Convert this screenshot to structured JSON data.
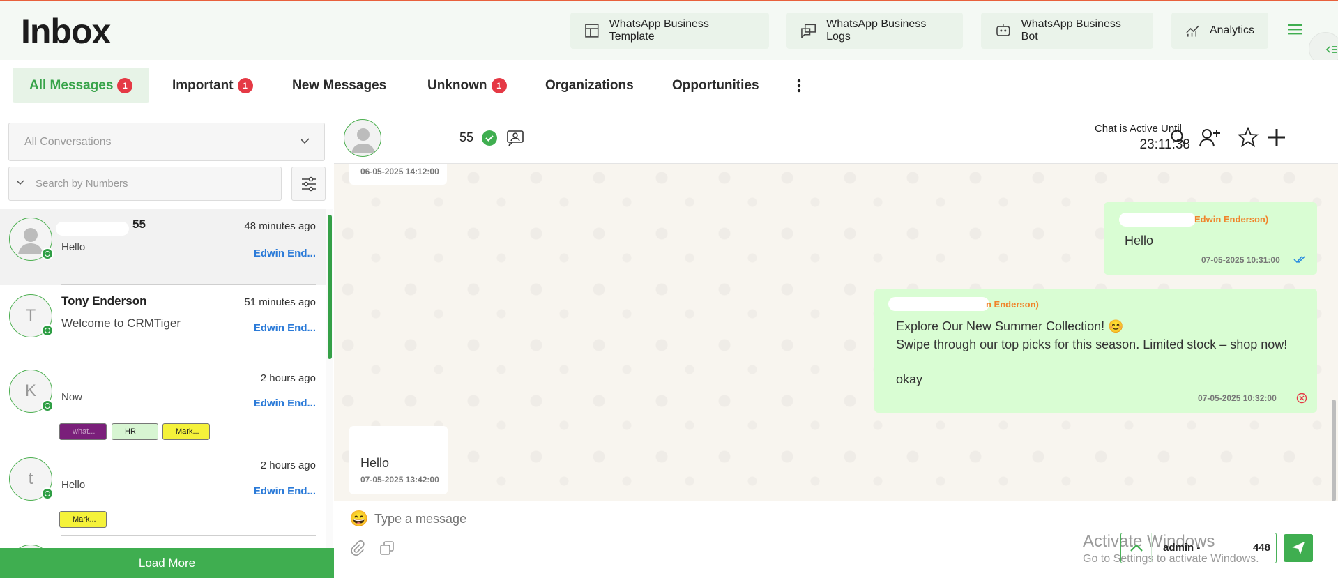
{
  "header": {
    "title": "Inbox",
    "buttons": [
      {
        "label": "WhatsApp Business Template",
        "icon": "template-icon"
      },
      {
        "label": "WhatsApp Business Logs",
        "icon": "logs-icon"
      },
      {
        "label": "WhatsApp Business Bot",
        "icon": "bot-icon"
      },
      {
        "label": "Analytics",
        "icon": "analytics-icon"
      }
    ]
  },
  "tabs": [
    {
      "label": "All Messages",
      "badge": "1",
      "active": true
    },
    {
      "label": "Important",
      "badge": "1"
    },
    {
      "label": "New Messages"
    },
    {
      "label": "Unknown",
      "badge": "1"
    },
    {
      "label": "Organizations"
    },
    {
      "label": "Opportunities"
    }
  ],
  "filters": {
    "conversation_select": "All Conversations",
    "search_placeholder": "Search by Numbers"
  },
  "conversations": [
    {
      "name": "55",
      "time": "48 minutes ago",
      "message": "Hello",
      "agent": "Edwin End...",
      "avatar": "person-icon"
    },
    {
      "name": "Tony Enderson",
      "time": "51 minutes ago",
      "message": "Welcome to CRMTiger",
      "agent": "Edwin End...",
      "avatar_letter": "T"
    },
    {
      "name": "",
      "time": "2 hours ago",
      "message": "Now",
      "agent": "Edwin End...",
      "avatar_letter": "K",
      "tags": [
        {
          "label": "what...",
          "color": "#7a1f7a"
        },
        {
          "label": "HR",
          "color": "#d7f5d2"
        },
        {
          "label": "Mark...",
          "color": "#f5f23a"
        }
      ]
    },
    {
      "name": "",
      "time": "2 hours ago",
      "message": "Hello",
      "agent": "Edwin End...",
      "avatar_letter": "t",
      "tags": [
        {
          "label": "Mark...",
          "color": "#f5f23a"
        }
      ]
    }
  ],
  "load_more": "Load More",
  "chat": {
    "contact_name": "55",
    "active_label": "Chat is Active Until",
    "active_time": "23:11:38",
    "messages": [
      {
        "dir": "in",
        "time": "06-05-2025 14:12:00"
      },
      {
        "dir": "out",
        "sender": "Edwin Enderson)",
        "text": "Hello",
        "time": "07-05-2025 10:31:00",
        "status": "read"
      },
      {
        "dir": "out",
        "sender": "n Enderson)",
        "line1": "Explore Our New Summer Collection! 😊",
        "line2": "Swipe through our top picks for this season. Limited stock – shop now!",
        "line3": "okay",
        "time": "07-05-2025 10:32:00",
        "status": "failed"
      },
      {
        "dir": "in",
        "text": "Hello",
        "time": "07-05-2025 13:42:00"
      }
    ]
  },
  "composer": {
    "placeholder": "Type a message",
    "agent_label": "admin -",
    "agent_count": "448"
  },
  "watermark": {
    "line1": "Activate Windows",
    "line2": "Go to Settings to activate Windows."
  },
  "colors": {
    "accent": "#3fae50",
    "badge": "#e53945",
    "agent_link": "#2a7ad8",
    "sender": "#f0832a"
  }
}
